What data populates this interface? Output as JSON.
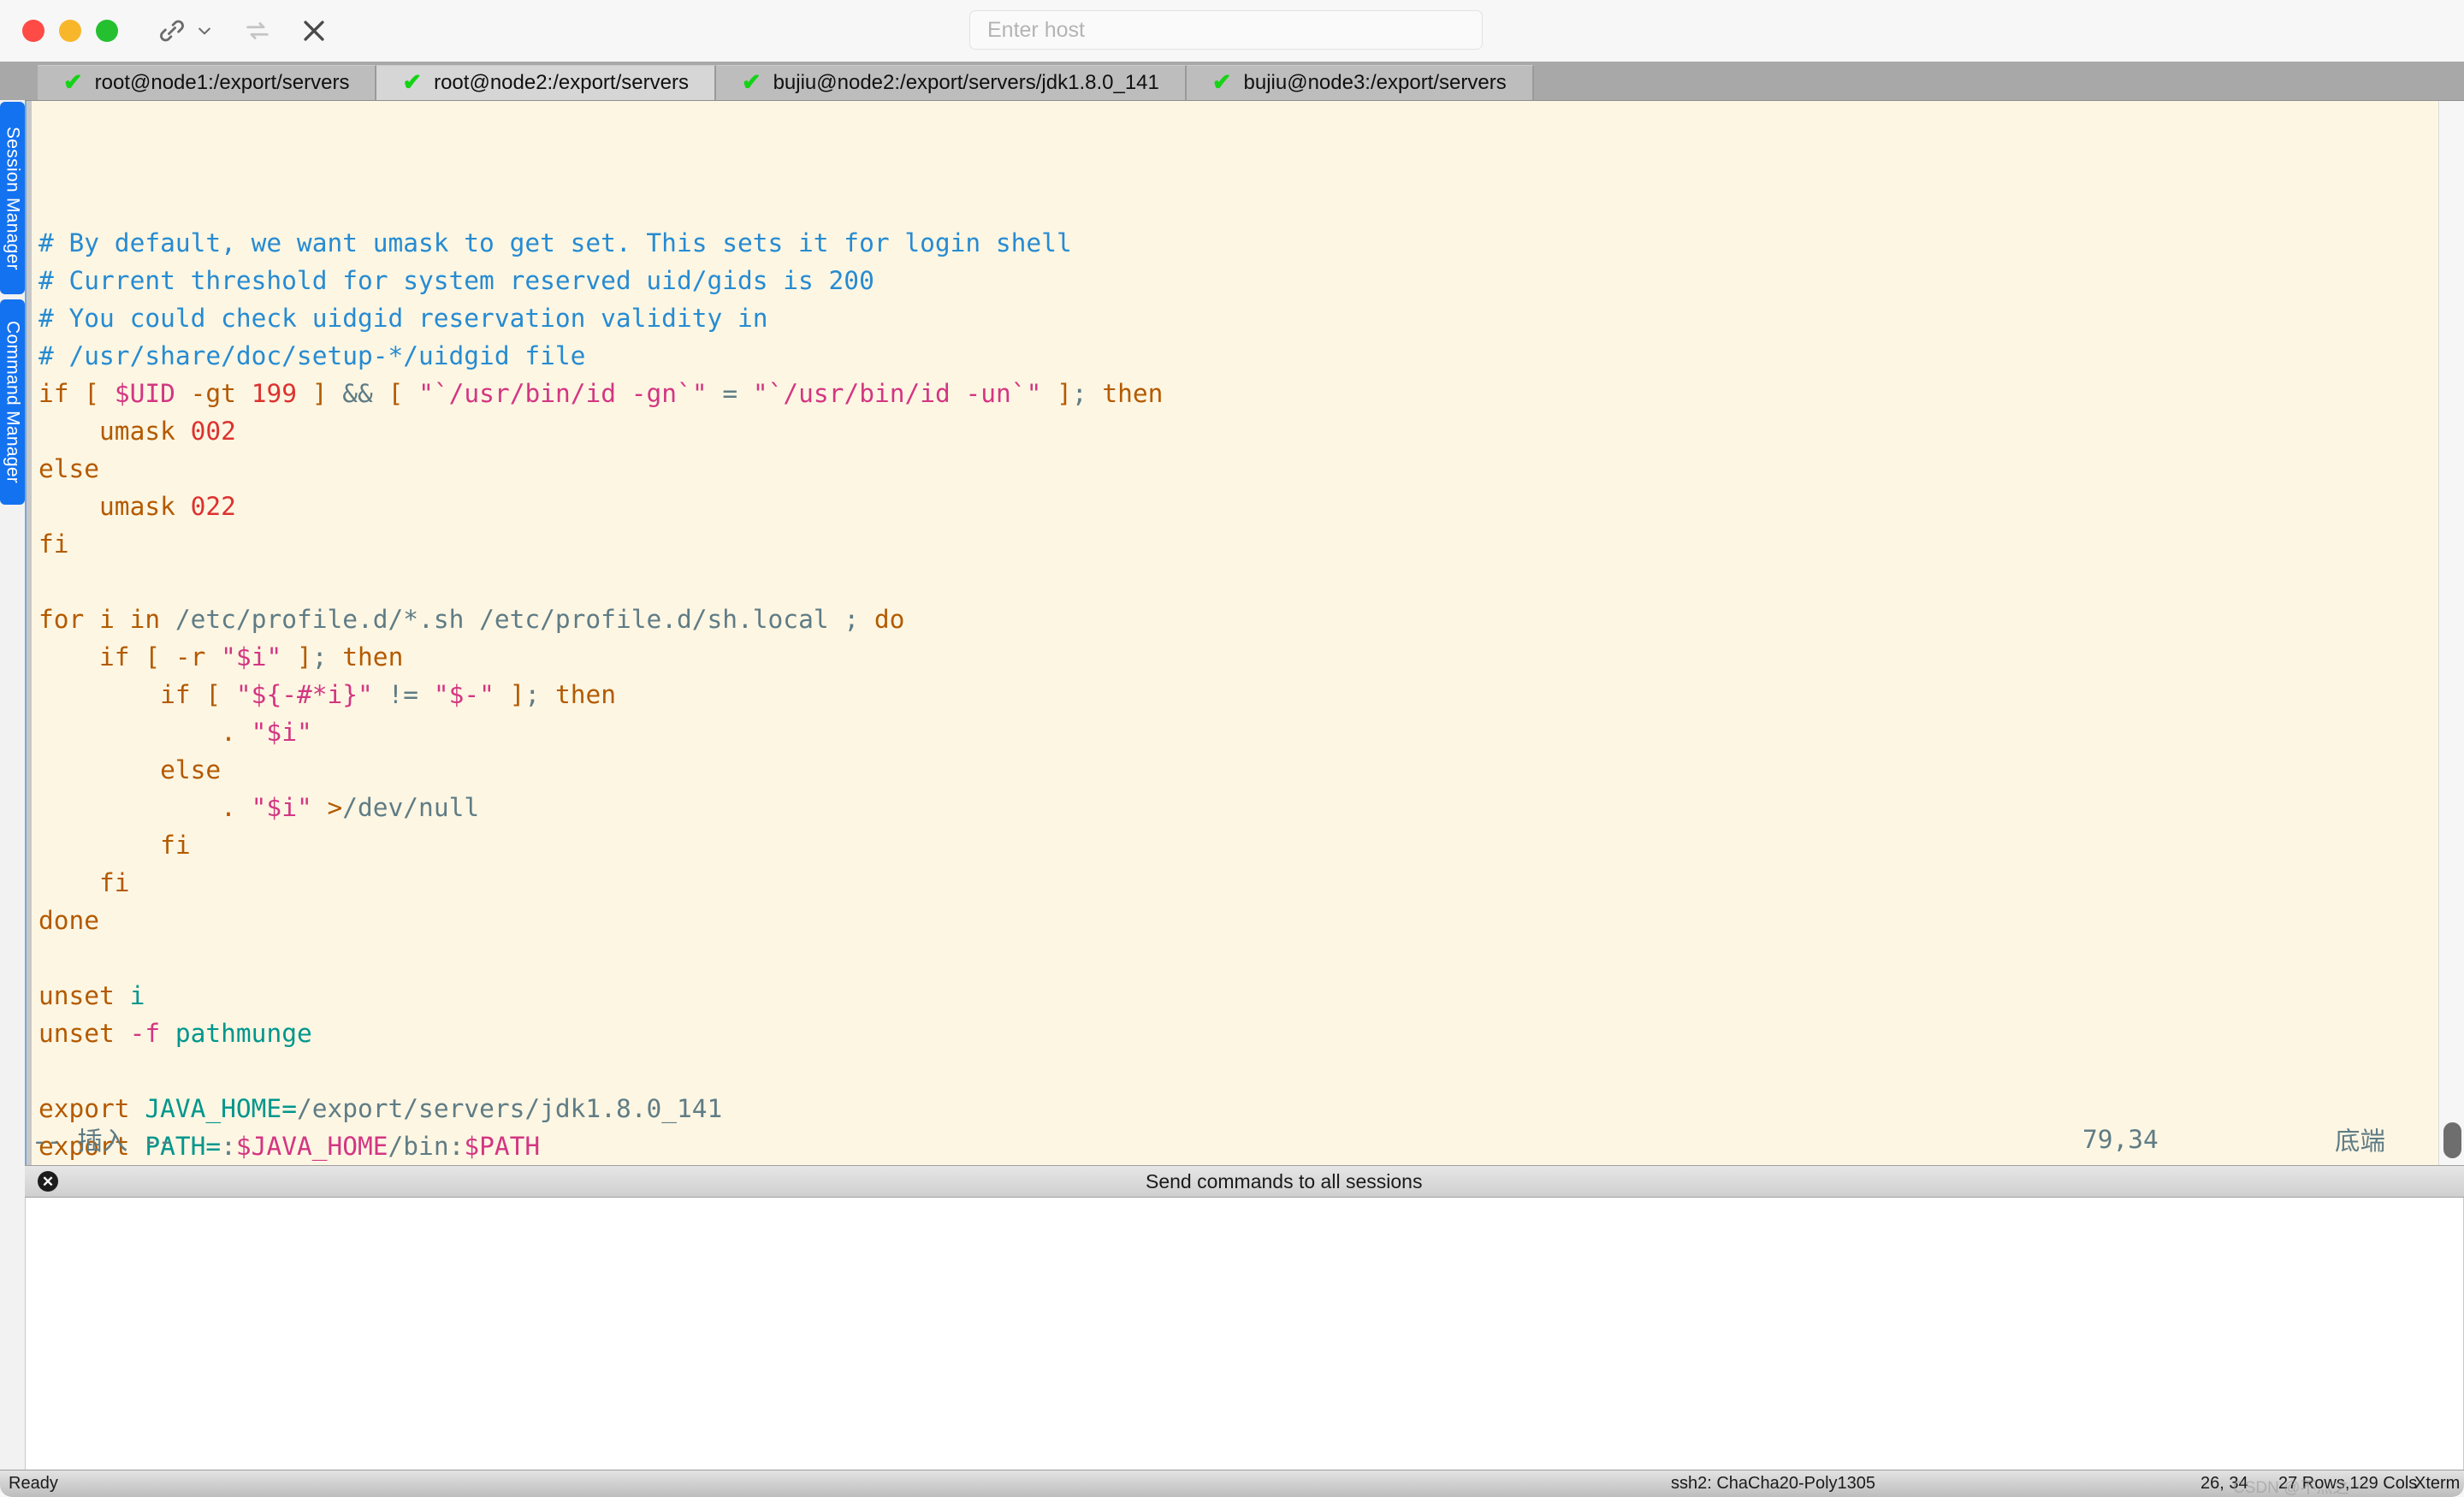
{
  "titlebar": {
    "traffic_lights": [
      {
        "name": "close",
        "color": "#ff4b45"
      },
      {
        "name": "minimize",
        "color": "#f8b62b"
      },
      {
        "name": "maximize",
        "color": "#24c030"
      }
    ],
    "tools": [
      {
        "name": "link-icon",
        "label": "Link"
      },
      {
        "name": "chevron-down-icon",
        "label": "More"
      },
      {
        "name": "reconnect-icon",
        "label": "Reconnect"
      },
      {
        "name": "close-icon",
        "label": "Close session"
      }
    ],
    "host_input": {
      "value": "",
      "placeholder": "Enter host"
    }
  },
  "sidebar": {
    "items": [
      {
        "label": "Session Manager"
      },
      {
        "label": "Command Manager"
      }
    ]
  },
  "tabs": [
    {
      "label": "root@node1:/export/servers",
      "status": "connected",
      "active": false
    },
    {
      "label": "root@node2:/export/servers",
      "status": "connected",
      "active": true
    },
    {
      "label": "bujiu@node2:/export/servers/jdk1.8.0_141",
      "status": "connected",
      "active": false
    },
    {
      "label": "bujiu@node3:/export/servers",
      "status": "connected",
      "active": false
    }
  ],
  "terminal": {
    "lines": [
      [
        {
          "t": "# By default, we want umask to get set. This sets it for login shell",
          "c": "c-comment"
        }
      ],
      [
        {
          "t": "# Current threshold for system reserved uid/gids is 200",
          "c": "c-comment"
        }
      ],
      [
        {
          "t": "# You could check uidgid reservation validity in",
          "c": "c-comment"
        }
      ],
      [
        {
          "t": "# /usr/share/doc/setup-*/uidgid file",
          "c": "c-comment"
        }
      ],
      [
        {
          "t": "if",
          "c": "c-stmt"
        },
        {
          "t": " ",
          "c": "c-plain"
        },
        {
          "t": "[",
          "c": "c-stmt"
        },
        {
          "t": " ",
          "c": "c-plain"
        },
        {
          "t": "$UID",
          "c": "c-ident"
        },
        {
          "t": " ",
          "c": "c-plain"
        },
        {
          "t": "-gt",
          "c": "c-stmt"
        },
        {
          "t": " ",
          "c": "c-plain"
        },
        {
          "t": "199",
          "c": "c-num"
        },
        {
          "t": " ",
          "c": "c-plain"
        },
        {
          "t": "]",
          "c": "c-stmt"
        },
        {
          "t": " ",
          "c": "c-plain"
        },
        {
          "t": "&&",
          "c": "c-op"
        },
        {
          "t": " ",
          "c": "c-plain"
        },
        {
          "t": "[",
          "c": "c-stmt"
        },
        {
          "t": " ",
          "c": "c-plain"
        },
        {
          "t": "\"`/usr/bin/id -gn`\"",
          "c": "c-ident"
        },
        {
          "t": " ",
          "c": "c-plain"
        },
        {
          "t": "=",
          "c": "c-op"
        },
        {
          "t": " ",
          "c": "c-plain"
        },
        {
          "t": "\"`/usr/bin/id -un`\"",
          "c": "c-ident"
        },
        {
          "t": " ",
          "c": "c-plain"
        },
        {
          "t": "]",
          "c": "c-stmt"
        },
        {
          "t": ";",
          "c": "c-op"
        },
        {
          "t": " ",
          "c": "c-plain"
        },
        {
          "t": "then",
          "c": "c-stmt"
        }
      ],
      [
        {
          "t": "    ",
          "c": "c-plain"
        },
        {
          "t": "umask",
          "c": "c-stmt"
        },
        {
          "t": " ",
          "c": "c-plain"
        },
        {
          "t": "002",
          "c": "c-num"
        }
      ],
      [
        {
          "t": "else",
          "c": "c-stmt"
        }
      ],
      [
        {
          "t": "    ",
          "c": "c-plain"
        },
        {
          "t": "umask",
          "c": "c-stmt"
        },
        {
          "t": " ",
          "c": "c-plain"
        },
        {
          "t": "022",
          "c": "c-num"
        }
      ],
      [
        {
          "t": "fi",
          "c": "c-stmt"
        }
      ],
      [
        {
          "t": "",
          "c": "c-plain"
        }
      ],
      [
        {
          "t": "for",
          "c": "c-stmt"
        },
        {
          "t": " ",
          "c": "c-plain"
        },
        {
          "t": "i",
          "c": "c-stmt"
        },
        {
          "t": " ",
          "c": "c-plain"
        },
        {
          "t": "in",
          "c": "c-stmt"
        },
        {
          "t": " ",
          "c": "c-plain"
        },
        {
          "t": "/etc/profile.d/*.sh /etc/profile.d/sh.local",
          "c": "c-str"
        },
        {
          "t": " ",
          "c": "c-plain"
        },
        {
          "t": ";",
          "c": "c-op"
        },
        {
          "t": " ",
          "c": "c-plain"
        },
        {
          "t": "do",
          "c": "c-stmt"
        }
      ],
      [
        {
          "t": "    ",
          "c": "c-plain"
        },
        {
          "t": "if",
          "c": "c-stmt"
        },
        {
          "t": " ",
          "c": "c-plain"
        },
        {
          "t": "[",
          "c": "c-stmt"
        },
        {
          "t": " ",
          "c": "c-plain"
        },
        {
          "t": "-r",
          "c": "c-stmt"
        },
        {
          "t": " ",
          "c": "c-plain"
        },
        {
          "t": "\"$i\"",
          "c": "c-ident"
        },
        {
          "t": " ",
          "c": "c-plain"
        },
        {
          "t": "]",
          "c": "c-stmt"
        },
        {
          "t": ";",
          "c": "c-op"
        },
        {
          "t": " ",
          "c": "c-plain"
        },
        {
          "t": "then",
          "c": "c-stmt"
        }
      ],
      [
        {
          "t": "        ",
          "c": "c-plain"
        },
        {
          "t": "if",
          "c": "c-stmt"
        },
        {
          "t": " ",
          "c": "c-plain"
        },
        {
          "t": "[",
          "c": "c-stmt"
        },
        {
          "t": " ",
          "c": "c-plain"
        },
        {
          "t": "\"${-#*i}\"",
          "c": "c-ident"
        },
        {
          "t": " ",
          "c": "c-plain"
        },
        {
          "t": "!=",
          "c": "c-op"
        },
        {
          "t": " ",
          "c": "c-plain"
        },
        {
          "t": "\"$-\"",
          "c": "c-ident"
        },
        {
          "t": " ",
          "c": "c-plain"
        },
        {
          "t": "]",
          "c": "c-stmt"
        },
        {
          "t": ";",
          "c": "c-op"
        },
        {
          "t": " ",
          "c": "c-plain"
        },
        {
          "t": "then",
          "c": "c-stmt"
        }
      ],
      [
        {
          "t": "            ",
          "c": "c-plain"
        },
        {
          "t": ".",
          "c": "c-stmt"
        },
        {
          "t": " ",
          "c": "c-plain"
        },
        {
          "t": "\"$i\"",
          "c": "c-ident"
        }
      ],
      [
        {
          "t": "        ",
          "c": "c-plain"
        },
        {
          "t": "else",
          "c": "c-stmt"
        }
      ],
      [
        {
          "t": "            ",
          "c": "c-plain"
        },
        {
          "t": ".",
          "c": "c-stmt"
        },
        {
          "t": " ",
          "c": "c-plain"
        },
        {
          "t": "\"$i\"",
          "c": "c-ident"
        },
        {
          "t": " ",
          "c": "c-plain"
        },
        {
          "t": ">",
          "c": "c-stmt"
        },
        {
          "t": "/dev/null",
          "c": "c-str"
        }
      ],
      [
        {
          "t": "        ",
          "c": "c-plain"
        },
        {
          "t": "fi",
          "c": "c-stmt"
        }
      ],
      [
        {
          "t": "    ",
          "c": "c-plain"
        },
        {
          "t": "fi",
          "c": "c-stmt"
        }
      ],
      [
        {
          "t": "done",
          "c": "c-stmt"
        }
      ],
      [
        {
          "t": "",
          "c": "c-plain"
        }
      ],
      [
        {
          "t": "unset",
          "c": "c-stmt"
        },
        {
          "t": " ",
          "c": "c-plain"
        },
        {
          "t": "i",
          "c": "c-type"
        }
      ],
      [
        {
          "t": "unset",
          "c": "c-stmt"
        },
        {
          "t": " ",
          "c": "c-plain"
        },
        {
          "t": "-f",
          "c": "c-ident"
        },
        {
          "t": " ",
          "c": "c-plain"
        },
        {
          "t": "pathmunge",
          "c": "c-type"
        }
      ],
      [
        {
          "t": "",
          "c": "c-plain"
        }
      ],
      [
        {
          "t": "export",
          "c": "c-stmt"
        },
        {
          "t": " ",
          "c": "c-plain"
        },
        {
          "t": "JAVA_HOME",
          "c": "c-type"
        },
        {
          "t": "=",
          "c": "c-type"
        },
        {
          "t": "/export/servers/jdk1.8.0_141",
          "c": "c-str"
        }
      ],
      [
        {
          "t": "export",
          "c": "c-stmt"
        },
        {
          "t": " ",
          "c": "c-plain"
        },
        {
          "t": "PATH",
          "c": "c-type"
        },
        {
          "t": "=",
          "c": "c-type"
        },
        {
          "t": ":",
          "c": "c-str"
        },
        {
          "t": "$JAVA_HOME",
          "c": "c-ident"
        },
        {
          "t": "/bin",
          "c": "c-str"
        },
        {
          "t": ":",
          "c": "c-str"
        },
        {
          "t": "$PATH",
          "c": "c-ident"
        }
      ]
    ],
    "status": {
      "mode": "-- 插入 --",
      "position": "79,34",
      "location": "底端"
    }
  },
  "broadcast": {
    "close_label": "✖",
    "label": "Send commands to all sessions",
    "input_value": ""
  },
  "statusbar": {
    "ready": "Ready",
    "cipher": "ssh2: ChaCha20-Poly1305",
    "cursor": "26, 34",
    "dimensions": "27 Rows,129 Cols",
    "emulation": "Xterm"
  },
  "watermark": "CSDN @不灬之"
}
